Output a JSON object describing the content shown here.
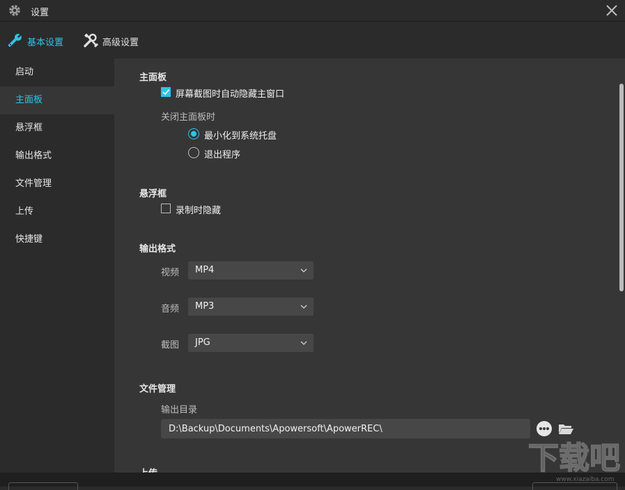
{
  "window": {
    "title": "设置"
  },
  "tabs": [
    {
      "label": "基本设置",
      "icon": "wrench-icon",
      "active": true
    },
    {
      "label": "高级设置",
      "icon": "tools-icon",
      "active": false
    }
  ],
  "sidebar": {
    "items": [
      {
        "label": "启动"
      },
      {
        "label": "主面板",
        "active": true
      },
      {
        "label": "悬浮框"
      },
      {
        "label": "输出格式"
      },
      {
        "label": "文件管理"
      },
      {
        "label": "上传"
      },
      {
        "label": "快捷键"
      }
    ]
  },
  "main_panel": {
    "title": "主面板",
    "auto_hide_label": "屏幕截图时自动隐藏主窗口",
    "auto_hide_checked": true,
    "close_label": "关闭主面板时",
    "close_options": [
      {
        "label": "最小化到系统托盘",
        "selected": true
      },
      {
        "label": "退出程序",
        "selected": false
      }
    ]
  },
  "float_box": {
    "title": "悬浮框",
    "hide_when_recording_label": "录制时隐藏",
    "hide_when_recording_checked": false
  },
  "output_format": {
    "title": "输出格式",
    "video_label": "视频",
    "video_value": "MP4",
    "audio_label": "音频",
    "audio_value": "MP3",
    "screenshot_label": "截图",
    "screenshot_value": "JPG"
  },
  "file_management": {
    "title": "文件管理",
    "output_dir_label": "输出目录",
    "output_dir_value": "D:\\Backup\\Documents\\Apowersoft\\ApowerREC\\"
  },
  "upload": {
    "title": "上传"
  },
  "watermark": {
    "text": "下载吧",
    "url": "www.xiazaiba.com"
  },
  "colors": {
    "accent": "#2fc3e9",
    "background": "#2b2b2b",
    "content_bg": "#363636",
    "input_bg": "#474747"
  }
}
